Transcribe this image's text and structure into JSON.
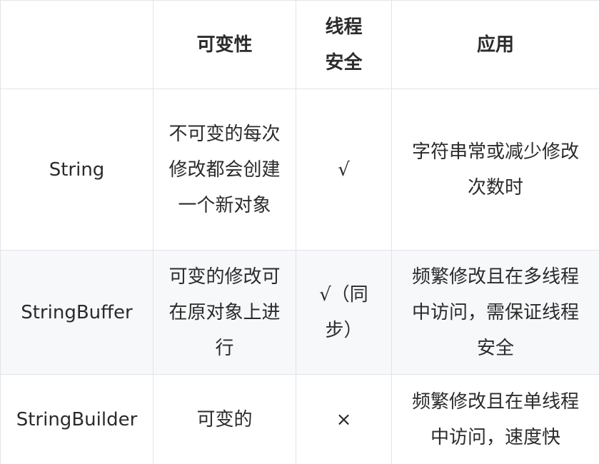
{
  "table": {
    "headers": [
      "",
      "可变性",
      "线程安全",
      "应用"
    ],
    "rows": [
      [
        "String",
        "不可变的每次修改都会创建一个新对象",
        "√",
        "字符串常或减少修改次数时"
      ],
      [
        "StringBuffer",
        "可变的修改可在原对象上进行",
        "√（同步）",
        "频繁修改且在多线程中访问，需保证线程安全"
      ],
      [
        "StringBuilder",
        "可变的",
        "×",
        "频繁修改且在单线程中访问，速度快"
      ]
    ]
  }
}
